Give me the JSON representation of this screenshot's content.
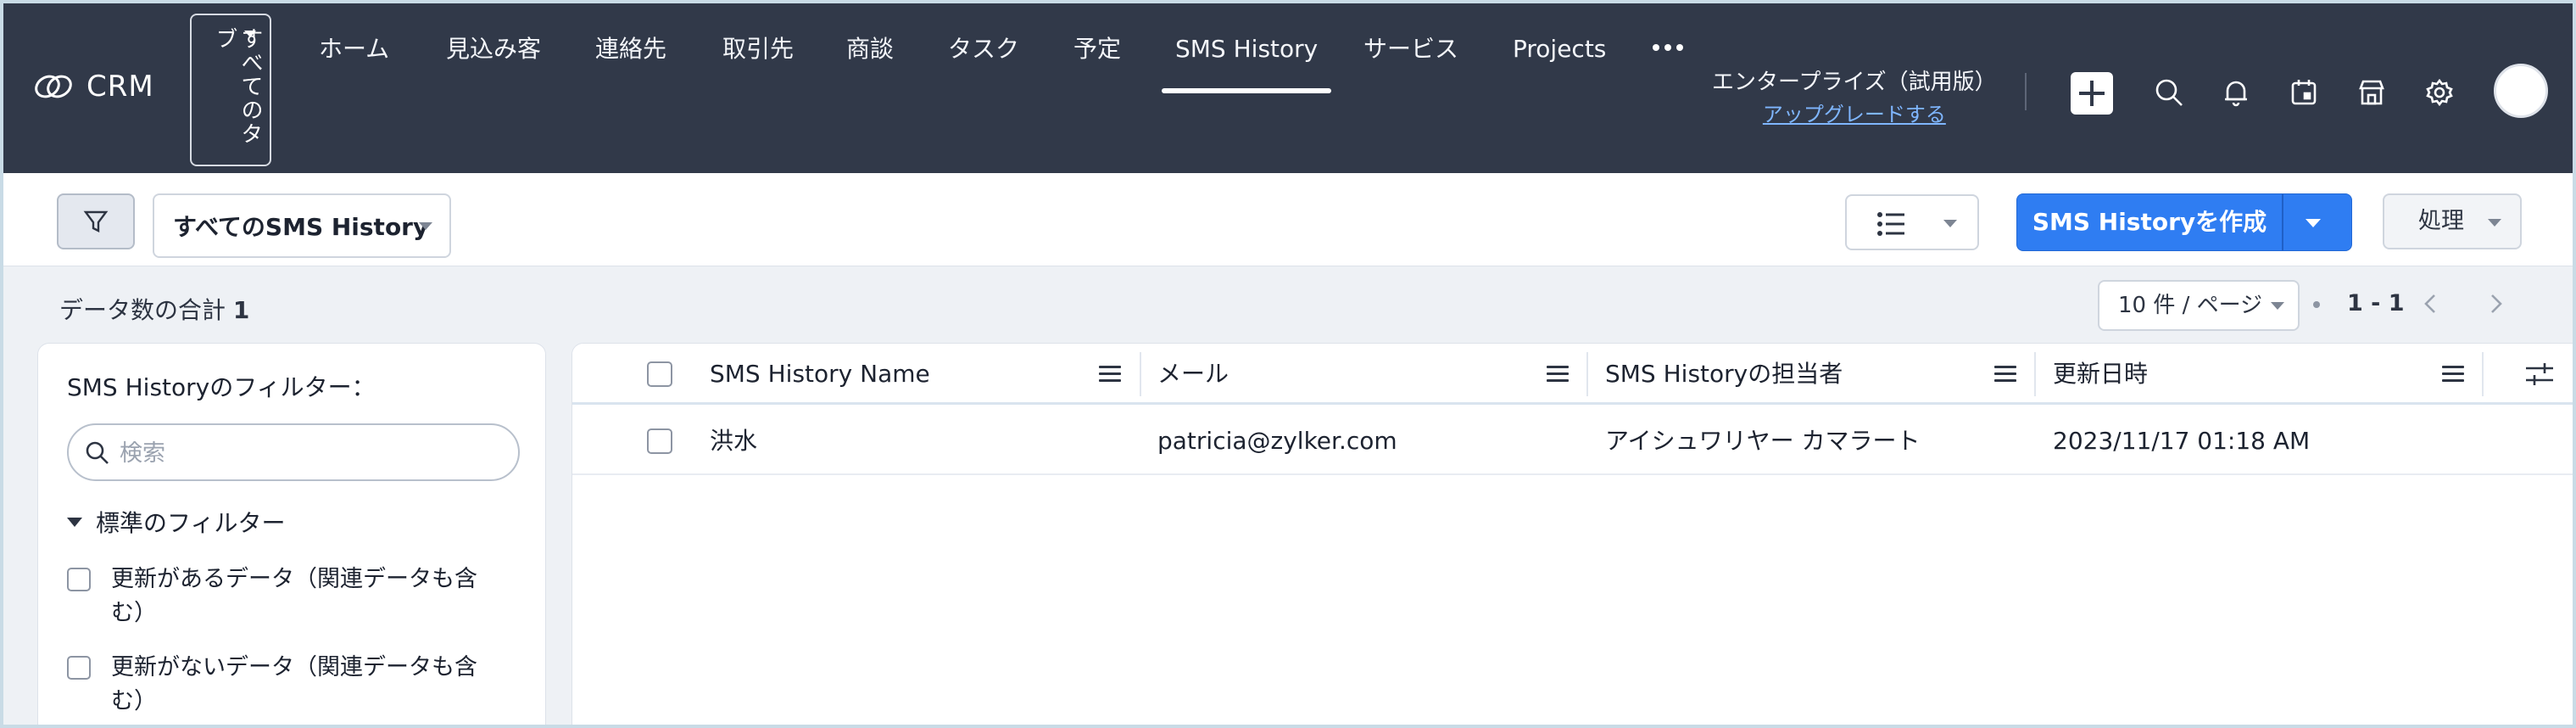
{
  "app": {
    "name": "CRM"
  },
  "header": {
    "all_tabs_label": "すべてのタブ",
    "nav": [
      {
        "label": "ホーム"
      },
      {
        "label": "見込み客"
      },
      {
        "label": "連絡先"
      },
      {
        "label": "取引先"
      },
      {
        "label": "商談"
      },
      {
        "label": "タスク"
      },
      {
        "label": "予定"
      },
      {
        "label": "SMS History",
        "active": true
      },
      {
        "label": "サービス"
      },
      {
        "label": "Projects"
      }
    ],
    "edition": "エンタープライズ（試用版）",
    "upgrade_link": "アップグレードする",
    "icons": [
      "plus-icon",
      "search-icon",
      "bell-icon",
      "calendar-icon",
      "marketplace-icon",
      "gear-icon",
      "avatar"
    ]
  },
  "toolbar": {
    "view_selector": "すべてのSMS History",
    "create_button": "SMS Historyを作成",
    "actions_button": "処理"
  },
  "summary": {
    "total_label": "データ数の合計",
    "total_count": "1",
    "per_page": "10 件 / ページ",
    "range": "1 - 1"
  },
  "filter_panel": {
    "title": "SMS Historyのフィルター：",
    "search_placeholder": "検索",
    "section_label": "標準のフィルター",
    "options": [
      {
        "label": "更新があるデータ（関連データも含む）"
      },
      {
        "label": "更新がないデータ（関連データも含む）"
      }
    ]
  },
  "table": {
    "columns": [
      "SMS History Name",
      "メール",
      "SMS Historyの担当者",
      "更新日時"
    ],
    "rows": [
      {
        "name": "洪水",
        "email": "patricia@zylker.com",
        "owner": "アイシュワリヤー カマラート",
        "modified": "2023/11/17 01:18 AM"
      }
    ]
  },
  "colors": {
    "topbar": "#313949",
    "primary": "#2f7df2",
    "background": "#eef1f5"
  }
}
